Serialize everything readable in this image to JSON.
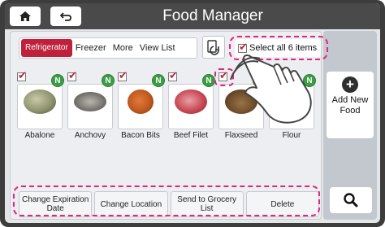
{
  "header": {
    "title": "Food Manager",
    "home_icon": "home-icon",
    "back_icon": "back-arrow-icon"
  },
  "tabs": [
    {
      "label": "Refrigerator",
      "active": true
    },
    {
      "label": "Freezer",
      "active": false
    },
    {
      "label": "More",
      "active": false
    },
    {
      "label": "View List",
      "active": false
    }
  ],
  "select_all": {
    "label": "Select all 6 items",
    "checked": true
  },
  "items": [
    {
      "name": "Abalone",
      "checked": true,
      "badge": "N",
      "color": "#8a8f6a"
    },
    {
      "name": "Anchovy",
      "checked": true,
      "badge": "N",
      "color": "#7d7a75"
    },
    {
      "name": "Bacon Bits",
      "checked": true,
      "badge": "N",
      "color": "#c0591f"
    },
    {
      "name": "Beef Filet",
      "checked": true,
      "badge": "N",
      "color": "#c84a55"
    },
    {
      "name": "Flaxseed",
      "checked": true,
      "badge": "N",
      "color": "#6b4a2a"
    },
    {
      "name": "Flour",
      "checked": true,
      "badge": "N",
      "color": "#f2ece0"
    }
  ],
  "actions": {
    "change_expiration": "Change Expiration Date",
    "change_location": "Change Location",
    "send_grocery": "Send to Grocery List",
    "delete": "Delete"
  },
  "side": {
    "add_label": "Add New Food",
    "search_icon": "search-icon"
  },
  "colors": {
    "accent": "#c0213a",
    "badge": "#3a9e45",
    "highlight": "#e0277d"
  }
}
